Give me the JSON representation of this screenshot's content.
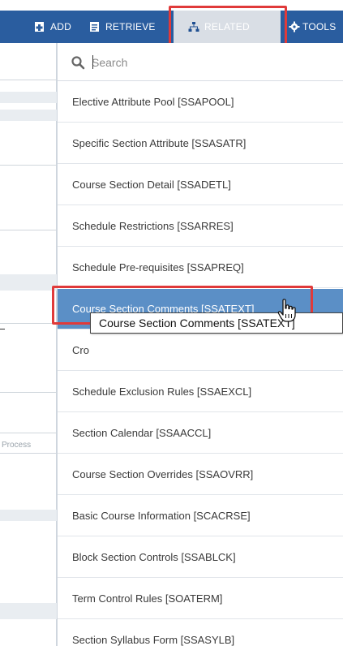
{
  "toolbar": {
    "add_label": "ADD",
    "retrieve_label": "RETRIEVE",
    "related_label": "RELATED",
    "tools_label": "TOOLS"
  },
  "background": {
    "process_label": "Process"
  },
  "menu": {
    "search_placeholder": "Search",
    "items": [
      {
        "label": "Elective Attribute Pool [SSAPOOL]"
      },
      {
        "label": "Specific Section Attribute [SSASATR]"
      },
      {
        "label": "Course Section Detail [SSADETL]"
      },
      {
        "label": "Schedule Restrictions [SSARRES]"
      },
      {
        "label": "Schedule Pre-requisites [SSAPREQ]"
      },
      {
        "label": "Course Section Comments [SSATEXT]"
      },
      {
        "label": "Cro"
      },
      {
        "label": "Schedule Exclusion Rules [SSAEXCL]"
      },
      {
        "label": "Section Calendar [SSAACCL]"
      },
      {
        "label": "Course Section Overrides [SSAOVRR]"
      },
      {
        "label": "Basic Course Information [SCACRSE]"
      },
      {
        "label": "Block Section Controls [SSABLCK]"
      },
      {
        "label": "Term Control Rules [SOATERM]"
      },
      {
        "label": "Section Syllabus Form [SSASYLB]"
      }
    ],
    "active_index": 5
  },
  "tooltip": {
    "text": "Course Section Comments [SSATEXT]"
  },
  "colors": {
    "toolbar_bg": "#2a5d9f",
    "active_item_bg": "#5b8fc6",
    "highlight_red": "#e03a3a"
  }
}
